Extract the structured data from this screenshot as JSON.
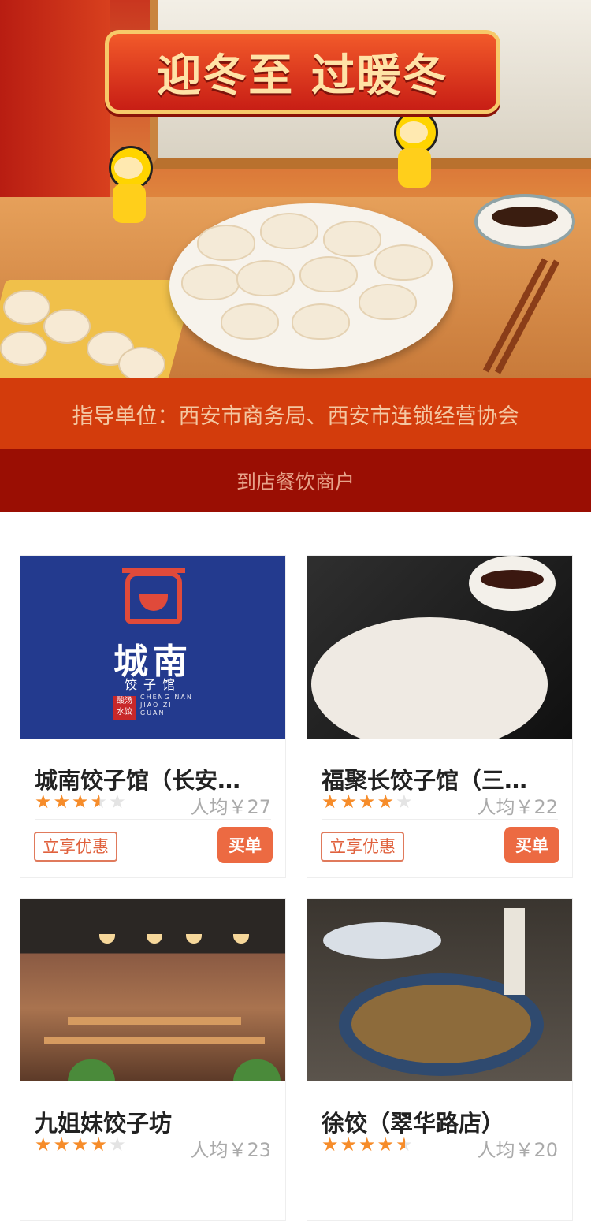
{
  "hero": {
    "banner_text": "迎冬至 过暖冬"
  },
  "guide_text": "指导单位：西安市商务局、西安市连锁经营协会",
  "section_title": "到店餐饮商户",
  "colors": {
    "hero_red": "#d33c0c",
    "section_red": "#9a0e03",
    "accent": "#ec6a42",
    "star": "#f68c2a"
  },
  "merchants": [
    {
      "name": "城南饺子馆（长安…",
      "rating": 3.5,
      "price": "人均￥27",
      "promo": "立享优惠",
      "buy": "买单",
      "logo": {
        "title": "城南",
        "sub": "饺子馆",
        "en": "CHENG NAN\nJIAO ZI\nGUAN",
        "seal": "酸汤水饺"
      }
    },
    {
      "name": "福聚长饺子馆（三…",
      "rating": 4,
      "price": "人均￥22",
      "promo": "立享优惠",
      "buy": "买单"
    },
    {
      "name": "九姐妹饺子坊",
      "rating": 4,
      "price": "人均￥23"
    },
    {
      "name": "徐饺（翠华路店）",
      "rating": 4.5,
      "price": "人均￥20"
    }
  ]
}
